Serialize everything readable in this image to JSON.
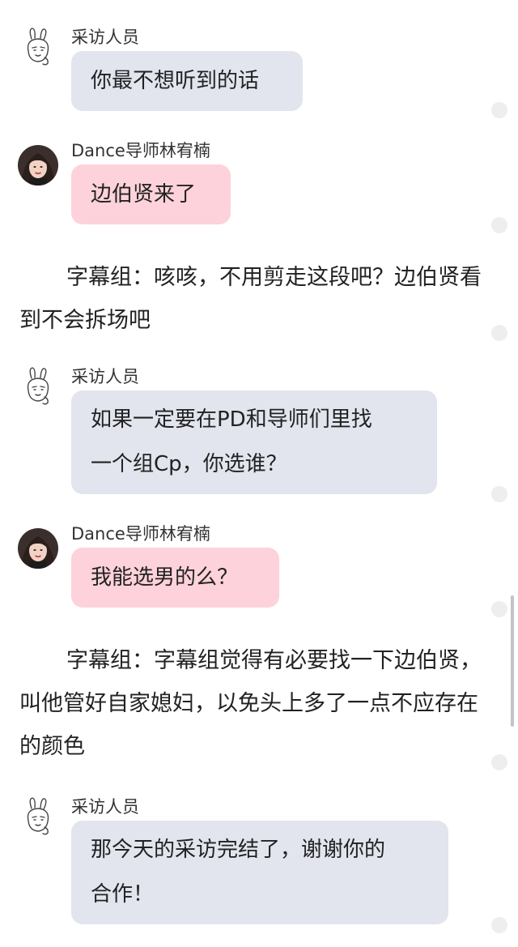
{
  "messages": [
    {
      "sender": "采访人员",
      "text": "你最不想听到的话"
    },
    {
      "sender": "Dance导师林宥楠",
      "text": "边伯贤来了"
    },
    {
      "narration": "字幕组：咳咳，不用剪走这段吧？边伯贤看到不会拆场吧"
    },
    {
      "sender": "采访人员",
      "line1": "如果一定要在PD和导师们里找",
      "line2": "一个组Cp，你选谁？"
    },
    {
      "sender": "Dance导师林宥楠",
      "text": "我能选男的么？"
    },
    {
      "narration": "字幕组：字幕组觉得有必要找一下边伯贤，叫他管好自家媳妇，以免头上多了一点不应存在的颜色"
    },
    {
      "sender": "采访人员",
      "line1": "那今天的采访完结了，谢谢你的",
      "line2": "合作！"
    }
  ],
  "avatars": {
    "interviewer": "rabbit-sticker-icon",
    "mentor": "profile-photo"
  },
  "colors": {
    "gray_bubble": "#e2e5ee",
    "pink_bubble": "#fdd2da"
  }
}
